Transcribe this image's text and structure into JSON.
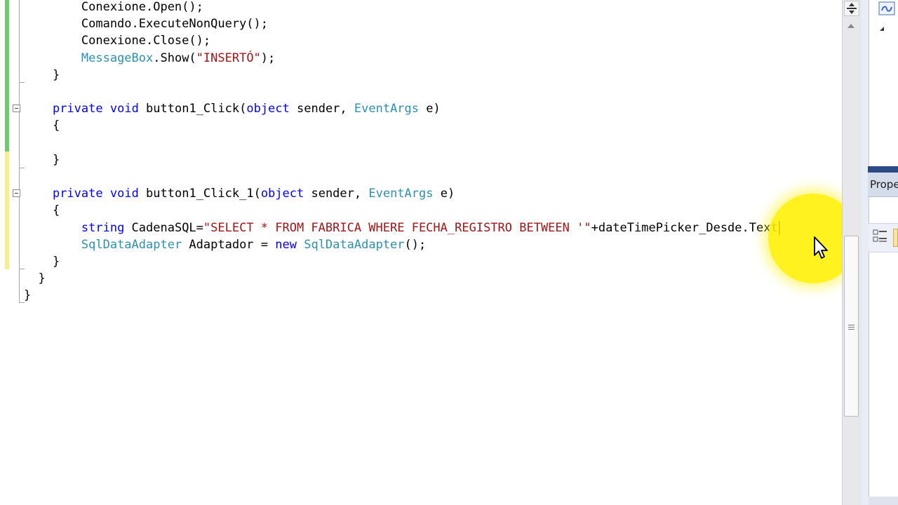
{
  "editor": {
    "lines": [
      [
        {
          "t": "        Conexione.Open();"
        }
      ],
      [
        {
          "t": "        Comando.ExecuteNonQuery();"
        }
      ],
      [
        {
          "t": "        Conexione.Close();"
        }
      ],
      [
        {
          "t": "        "
        },
        {
          "t": "MessageBox",
          "c": "ty"
        },
        {
          "t": ".Show("
        },
        {
          "t": "\"INSERTÓ\"",
          "c": "str"
        },
        {
          "t": ");"
        }
      ],
      [
        {
          "t": "    }"
        }
      ],
      [
        {
          "t": ""
        }
      ],
      [
        {
          "t": "    "
        },
        {
          "t": "private",
          "c": "kw"
        },
        {
          "t": " "
        },
        {
          "t": "void",
          "c": "kw"
        },
        {
          "t": " button1_Click("
        },
        {
          "t": "object",
          "c": "kw"
        },
        {
          "t": " sender, "
        },
        {
          "t": "EventArgs",
          "c": "ty"
        },
        {
          "t": " e)"
        }
      ],
      [
        {
          "t": "    {"
        }
      ],
      [
        {
          "t": ""
        }
      ],
      [
        {
          "t": "    }"
        }
      ],
      [
        {
          "t": ""
        }
      ],
      [
        {
          "t": "    "
        },
        {
          "t": "private",
          "c": "kw"
        },
        {
          "t": " "
        },
        {
          "t": "void",
          "c": "kw"
        },
        {
          "t": " button1_Click_1("
        },
        {
          "t": "object",
          "c": "kw"
        },
        {
          "t": " sender, "
        },
        {
          "t": "EventArgs",
          "c": "ty"
        },
        {
          "t": " e)"
        }
      ],
      [
        {
          "t": "    {"
        }
      ],
      [
        {
          "t": "        "
        },
        {
          "t": "string",
          "c": "kw"
        },
        {
          "t": " CadenaSQL="
        },
        {
          "t": "\"SELECT * FROM FABRICA WHERE FECHA_REGISTRO BETWEEN '\"",
          "c": "str"
        },
        {
          "t": "+dateTimePicker_Desde.Text"
        }
      ],
      [
        {
          "t": "        "
        },
        {
          "t": "SqlDataAdapter",
          "c": "ty"
        },
        {
          "t": " Adaptador = "
        },
        {
          "t": "new",
          "c": "kw"
        },
        {
          "t": " "
        },
        {
          "t": "SqlDataAdapter",
          "c": "ty"
        },
        {
          "t": "();"
        }
      ],
      [
        {
          "t": "    }"
        }
      ],
      [
        {
          "t": "  }"
        }
      ],
      [
        {
          "t": "}"
        }
      ]
    ],
    "caret_line": 13
  },
  "properties_pane": {
    "title": "Properties"
  },
  "colors": {
    "keyword": "#0000ff",
    "type": "#2b91af",
    "string": "#a31515",
    "changed_saved": "#6ccb6c",
    "changed_unsaved": "#f5f08a",
    "cursor_highlight": "#fff000"
  }
}
